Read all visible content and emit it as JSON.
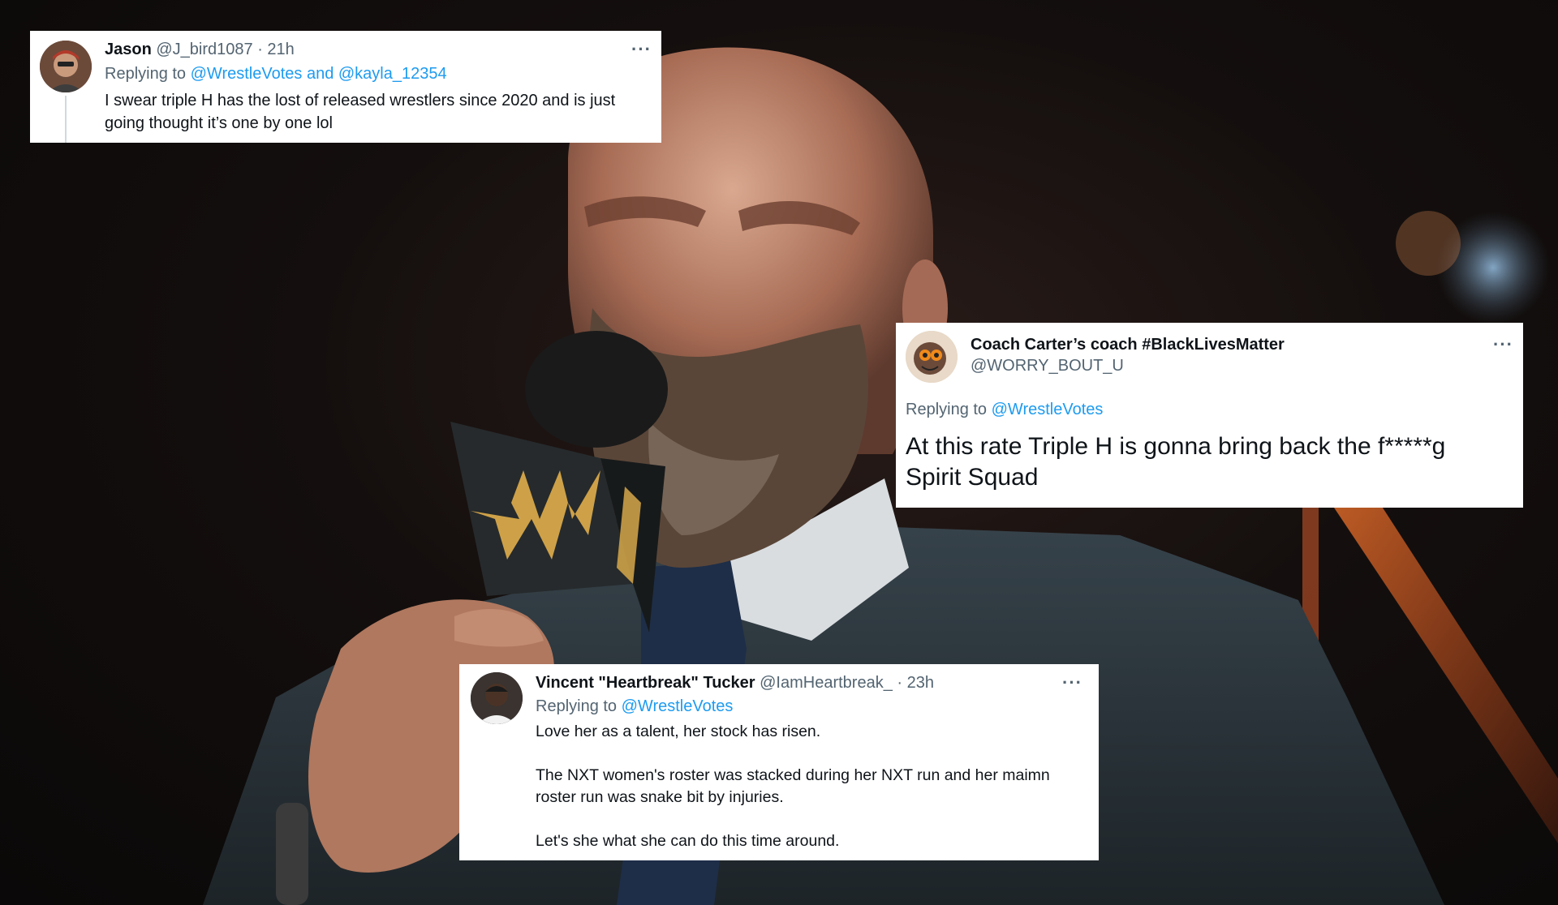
{
  "background": {
    "subject": "man-speaking-into-microphone-photo",
    "colors": {
      "dark": "#140f0e",
      "suit": "#2b3338",
      "skin": "#b0785f",
      "beard": "#5a4638",
      "logo": "#d7a84a"
    }
  },
  "tweets": [
    {
      "name": "Jason",
      "handle": "@J_bird1087",
      "time": "· 21h",
      "replying_prefix": "Replying to ",
      "replying_to": "@WrestleVotes and @kayla_12354",
      "lines": [
        "I swear triple H has the lost of released wrestlers since 2020 and is just",
        "going thought it’s one by one lol"
      ],
      "more": "···"
    },
    {
      "name": "Coach Carter’s coach #BlackLivesMatter",
      "handle": "@WORRY_BOUT_U",
      "replying_prefix": "Replying to ",
      "replying_to": "@WrestleVotes",
      "lines": [
        "At this rate Triple H is gonna bring back the f*****g",
        "Spirit Squad"
      ],
      "more": "···"
    },
    {
      "name": "Vincent \"Heartbreak\" Tucker",
      "handle": "@IamHeartbreak_",
      "time": "· 23h",
      "replying_prefix": "Replying to ",
      "replying_to": "@WrestleVotes",
      "lines": [
        "Love her as a talent, her stock has risen.",
        "The NXT women's roster was stacked during her NXT run and her maimn",
        "roster run was snake bit by injuries.",
        "Let's she what she can do this time around."
      ],
      "more": "···"
    }
  ]
}
